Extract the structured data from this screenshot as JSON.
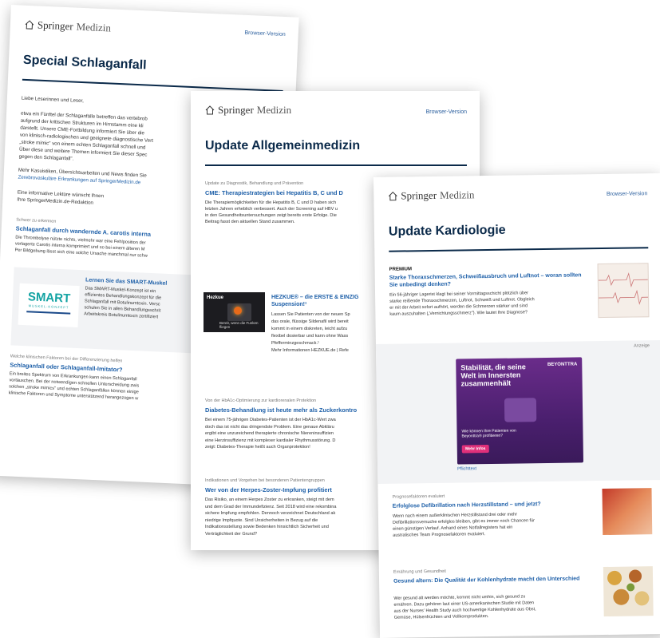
{
  "brand": {
    "springer": "Springer",
    "medizin": "Medizin",
    "browser_version": "Browser-Version"
  },
  "card1": {
    "title": "Special Schlaganfall",
    "greeting": "Liebe Leserinnen und Leser,",
    "intro_lines": [
      "etwa ein Fünftel der Schlaganfälle betreffen das vertebrob",
      "aufgrund der kritischen Strukturen im Hirnstamm eine kli",
      "darstellt. Unsere CME-Fortbildung informiert Sie über die",
      "von klinisch-radiologischen und geeignete diagnostische Vert",
      "„stroke mimic\" von einem echten Schlaganfall schnell und",
      "Über diese und weitere Themen informiert Sie dieser Spec",
      "gegen den Schlaganfall\"."
    ],
    "more_lines": [
      "Mehr Kasuistiken, Übersichtsarbeiten und News finden Sie",
      "Zerebrovaskuläre Erkrankungen auf SpringerMedizin.de"
    ],
    "closing_lines": [
      "Eine informative Lektüre wünscht Ihnen",
      "Ihre SpringerMedizin.de-Redaktion"
    ],
    "a1_kicker": "Schwer zu erkennen",
    "a1_title": "Schlaganfall durch wandernde A. carotis interna",
    "a1_lines": [
      "Die Thrombolyse nützte nichts, vielmehr war eine Fehlposition der",
      "verlagerte Carotis interna komprimiert und so bei einem älteren M",
      "Per Bildgebung lässt sich eine solche Ursache manchmal nur schw"
    ],
    "smart_logo": "SMART",
    "smart_logo_sub": "MUSKEL-KONZEPT",
    "smart_title": "Lernen Sie das SMART-Muskel",
    "smart_lines": [
      "Das SMART-Muskel-Konzept ist ein",
      "effizientes Behandlungskonzept für die",
      "Schlaganfall mit Botulinumtoxin. Versc",
      "schulen Sie in allen Behandlungsschrit",
      "Arbeitskreis Botulinumtoxin zertifiziert"
    ],
    "a2_kicker": "Welche klinischen Faktoren bei der Differenzierung helfen",
    "a2_title": "Schlaganfall oder Schlaganfall-Imitator?",
    "a2_lines": [
      "Ein breites Spektrum von Erkrankungen kann einen Schlaganfall",
      "vortäuschen. Bei der notwendigen schnellen Unterscheidung zwis",
      "solchen „stroke mimics\" und echten Schlaganfällen können einige",
      "klinische Faktoren und Symptome unterstützend herangezogen w"
    ]
  },
  "card2": {
    "title": "Update Allgemeinmedizin",
    "a1_kicker": "Update zu Diagnostik, Behandlung und Prävention",
    "a1_title": "CME: Therapiestrategien bei Hepatitis B, C und D",
    "a1_lines": [
      "Die Therapiemöglichkeiten für die Hepatitis B, C und D haben sich",
      "letzten Jahren erheblich verbessert. Auch der Screening auf HBV u",
      "in den Gesundheitsuntersuchungen zeigt bereits erste Erfolge. Die",
      "Beitrag fasst den aktuellen Stand zusammen."
    ],
    "ad_img_brand": "Hezkue",
    "ad_img_text": "Bereit, wenn die Funken fliegen",
    "ad_title": "HEZKUE® – die ERSTE & EINZIG",
    "ad_title2": "Suspension!¹",
    "ad_lines": [
      "Lassen Sie Patienten von der neuen Sp",
      "das orale, flüssige Sildenafil wird bereit",
      "kommt in einem diskreten, leicht aufzu",
      "flexibel dosierbar und kann ohne Wass",
      "Pfefferminzgeschmack.¹",
      "Mehr Informationen HEZKUE.de | Refe"
    ],
    "a2_kicker": "Von der HbA1c-Optimierung zur kardiorenalen Protektion",
    "a2_title": "Diabetes-Behandlung ist heute mehr als Zuckerkontro",
    "a2_lines": [
      "Bei einem 75-jährigen Diabetes-Patienten ist der HbA1c-Wert zwa",
      "doch das ist nicht das dringendste Problem. Eine genaue Abkläru",
      "ergibt eine unzureichend therapierte chronische Niereninsuffizien",
      "eine Herzinsuffizienz mit komplexer kardialer Rhythmusstörung. D",
      "zeigt: Diabetes-Therapie heißt auch Organprotektion!"
    ],
    "a3_kicker": "Indikationen und Vorgehen bei besonderen Patientengruppen",
    "a3_title": "Wer von der Herpes-Zoster-Impfung profitiert",
    "a3_lines": [
      "Das Risiko, an einem Herpes Zoster zu erkranken, steigt mit dem",
      "und dem Grad der Immundefizienz. Seit 2018 wird eine rekombina",
      "sichere Impfung empfohlen. Dennoch verzeichnet Deutschland ak",
      "niedrige Impfquote. Sind Unsicherheiten in Bezug auf die",
      "Indikationsstellung sowie Bedenken hinsichtlich Sicherheit und",
      "Verträglichkeit der Grund?"
    ]
  },
  "card3": {
    "title": "Update Kardiologie",
    "premium": "PREMIUM",
    "a1_title": "Starke Thoraxschmerzen, Schweißausbruch und Luftnot – woran sollten Sie unbedingt denken?",
    "a1_lines": [
      "Ein 56-jähriger Lagerist klagt bei seiner Vormittagsschicht plötzlich über",
      "starke reißende Thoraxschmerzen, Luftnot, Schweiß und Luftnot. Obgleich",
      "er mit der Arbeit sofort aufhört, werden die Schmerzen stärker und sind",
      "kaum auszuhalten („Vernichtungsschmerz\"). Wie lautet Ihre Diagnose?"
    ],
    "anzeige": "Anzeige",
    "ad_headline": "Stabilität, die seine Welt im Innersten zusammenhält",
    "ad_brand": "BEYONTTRA",
    "ad_question": "Wie können Ihre Patienten von Beyonttra® profitieren?",
    "ad_button": "Mehr Infos",
    "ad_bottom": "Pflichttext",
    "a2_kicker": "Prognosefaktoren evaluiert",
    "a2_title": "Erfolglose Defibrillation nach Herzstillstand – und jetzt?",
    "a2_lines": [
      "Wenn nach einem außerklinischen Herzstillstand drei oder mehr",
      "Defibrillationsversuche erfolglos bleiben, gibt es immer noch Chancen für",
      "einen günstigen Verlauf. Anhand eines Notfallregisters hat ein",
      "australisches Team Prognosefaktoren evaluiert."
    ],
    "a3_kicker": "Ernährung und Gesundheit",
    "a3_title": "Gesund altern: Die Qualität der Kohlenhydrate macht den Unterschied",
    "a3_lines": [
      "Wer gesund alt werden möchte, kommt nicht umhin, sich gesund zu",
      "ernähren. Dazu gehören laut einer US-amerikanischen Studie mit Daten",
      "aus der Nurses' Health Study auch hochwertige Kohlenhydrate aus Obst,",
      "Gemüse, Hülsenfrüchten und Vollkornprodukten."
    ]
  }
}
